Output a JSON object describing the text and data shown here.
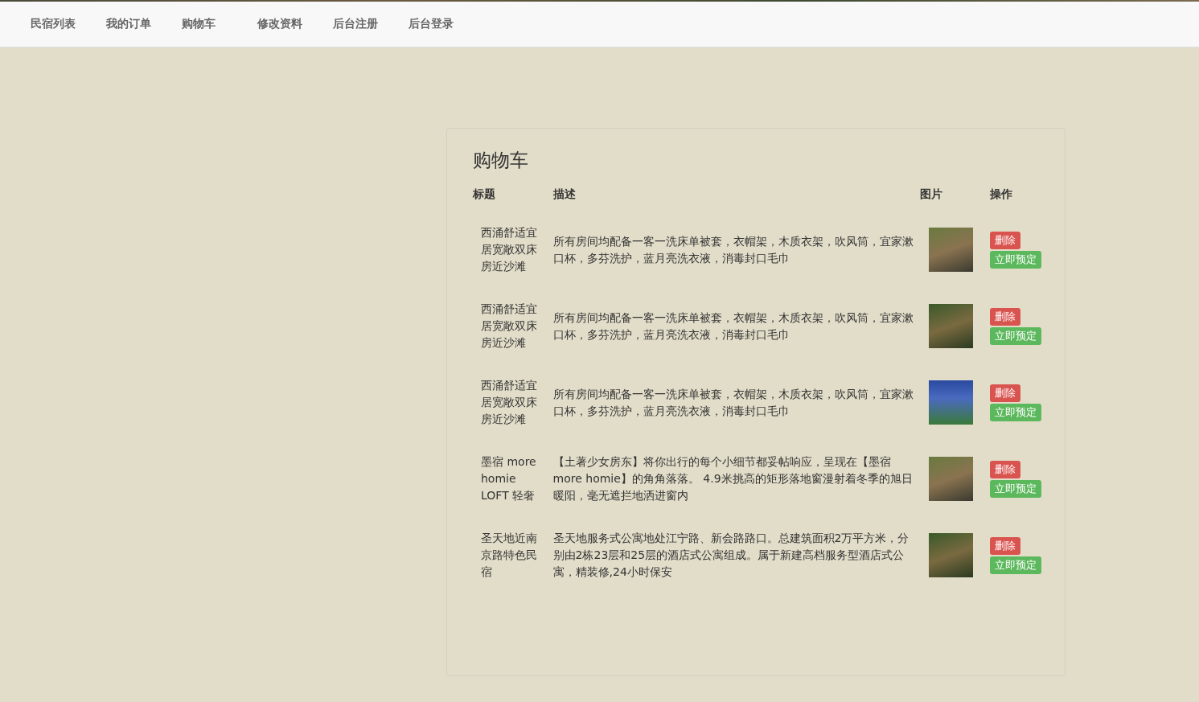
{
  "nav": {
    "items": [
      {
        "label": "民宿列表"
      },
      {
        "label": "我的订单"
      },
      {
        "label": "购物车"
      },
      {
        "label": "修改资料"
      },
      {
        "label": "后台注册"
      },
      {
        "label": "后台登录"
      }
    ]
  },
  "cart": {
    "title": "购物车",
    "columns": [
      "标题",
      "描述",
      "图片",
      "操作"
    ],
    "rows": [
      {
        "title": "西涌舒适宜居宽敞双床房近沙滩",
        "description": "所有房间均配备一客一洗床单被套，衣帽架，木质衣架，吹风筒，宜家漱口杯，多芬洗护，蓝月亮洗衣液，消毒封口毛巾",
        "delete": "删除",
        "book": "立即预定"
      },
      {
        "title": "西涌舒适宜居宽敞双床房近沙滩",
        "description": "所有房间均配备一客一洗床单被套，衣帽架，木质衣架，吹风筒，宜家漱口杯，多芬洗护，蓝月亮洗衣液，消毒封口毛巾",
        "delete": "删除",
        "book": "立即预定"
      },
      {
        "title": "西涌舒适宜居宽敞双床房近沙滩",
        "description": "所有房间均配备一客一洗床单被套，衣帽架，木质衣架，吹风筒，宜家漱口杯，多芬洗护，蓝月亮洗衣液，消毒封口毛巾",
        "delete": "删除",
        "book": "立即预定"
      },
      {
        "title": "墨宿 more homie LOFT 轻奢",
        "description": "【土著少女房东】将你出行的每个小细节都妥帖响应，呈现在【墨宿 more homie】的角角落落。 4.9米挑高的矩形落地窗漫射着冬季的旭日暖阳，毫无遮拦地洒进窗内",
        "delete": "删除",
        "book": "立即预定"
      },
      {
        "title": "圣天地近南京路特色民宿",
        "description": "圣天地服务式公寓地处江宁路、新会路路口。总建筑面积2万平方米，分别由2栋23层和25层的酒店式公寓组成。属于新建高档服务型酒店式公寓，精装修,24小时保安",
        "delete": "删除",
        "book": "立即预定"
      }
    ]
  }
}
